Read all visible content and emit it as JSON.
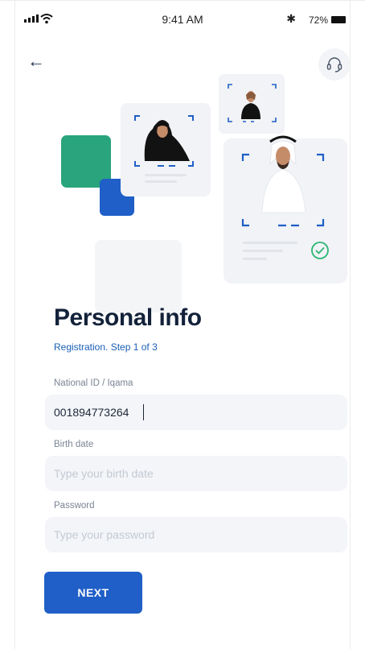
{
  "status_bar": {
    "time": "9:41 AM",
    "battery": "72%",
    "bluetooth_glyph": "✱"
  },
  "header": {
    "back_glyph": "←",
    "support_icon": "headset-icon"
  },
  "illustration": {
    "icons": [
      "woman-hijab-avatar",
      "man-ghutra-avatar",
      "verified-check-icon"
    ],
    "colors": {
      "green": "#2aa47d",
      "blue": "#1f5fc7",
      "card": "#f1f3f6",
      "check": "#2bb673"
    }
  },
  "page": {
    "title": "Personal info",
    "subtitle": "Registration. Step 1 of 3"
  },
  "form": {
    "national_id": {
      "label": "National ID / Iqama",
      "value": "001894773264"
    },
    "birth_date": {
      "label": "Birth date",
      "placeholder": "Type your birth date"
    },
    "password": {
      "label": "Password",
      "placeholder": "Type your password"
    }
  },
  "actions": {
    "next_label": "NEXT"
  },
  "theme": {
    "primary": "#1f5fc7",
    "title": "#13223a",
    "field_bg": "#f3f5f8"
  }
}
